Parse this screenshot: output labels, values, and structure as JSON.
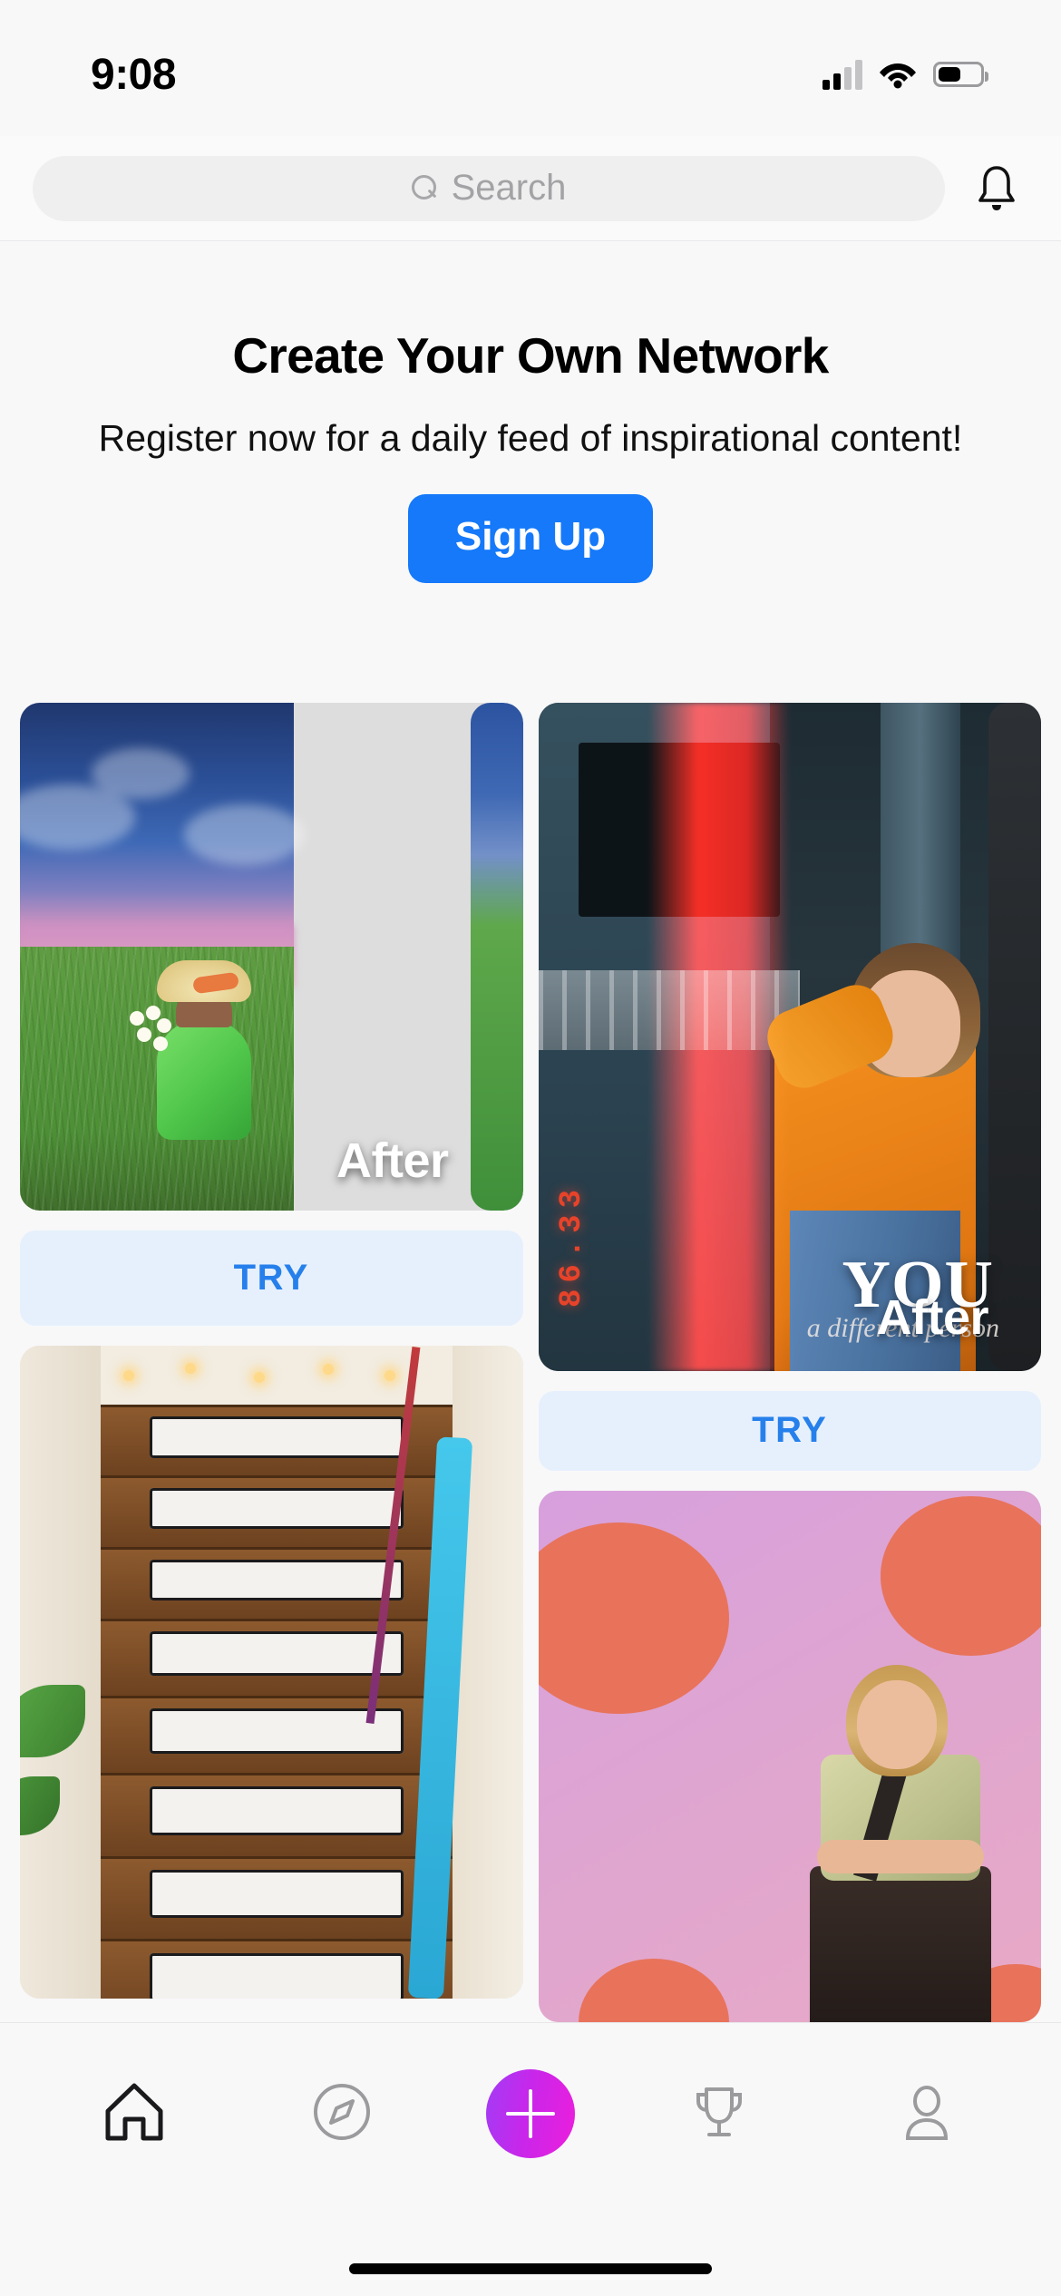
{
  "status_bar": {
    "time": "9:08",
    "cellular_icon": "cellular-signal-icon",
    "cellular_bars_filled": 2,
    "cellular_bars_total": 4,
    "wifi_icon": "wifi-icon",
    "battery_icon": "battery-icon",
    "battery_level_percent": 52
  },
  "header": {
    "search": {
      "icon": "search-icon",
      "placeholder": "Search",
      "value": ""
    },
    "notifications_icon": "bell-icon"
  },
  "promo": {
    "title": "Create Your Own Network",
    "subtitle": "Register now for a daily feed of inspirational content!",
    "signup_label": "Sign Up",
    "signup_color": "#1579f9"
  },
  "feed": {
    "try_label": "TRY",
    "try_text_color": "#2680eb",
    "try_bg_color": "#e6f0fd",
    "cards": [
      {
        "id": "card-field-after",
        "overlay_label": "After",
        "description": "woman in green dress with flowers in grass field at sunset",
        "has_try_button": true
      },
      {
        "id": "card-orange-you-after",
        "overlay_label": "After",
        "overlay_title": "YOU",
        "overlay_script": "a different person",
        "led_text": "86.33",
        "description": "woman in orange shirt leaning on building with red light streak",
        "has_try_button": true
      },
      {
        "id": "card-painted-stairs",
        "description": "wooden staircase with painted book mural and string lights",
        "has_try_button": false
      },
      {
        "id": "card-pink-dots",
        "description": "smiling woman with arms crossed against pink backdrop with orange dots",
        "has_try_button": false
      }
    ]
  },
  "tab_bar": {
    "items": [
      {
        "name": "home-tab",
        "icon": "home-icon",
        "active": true
      },
      {
        "name": "discover-tab",
        "icon": "compass-icon",
        "active": false
      },
      {
        "name": "create-tab",
        "icon": "plus-icon",
        "active": false
      },
      {
        "name": "leaderboard-tab",
        "icon": "trophy-icon",
        "active": false
      },
      {
        "name": "profile-tab",
        "icon": "person-icon",
        "active": false
      }
    ],
    "fab_gradient_start": "#a23cf5",
    "fab_gradient_end": "#ed1edc",
    "active_color": "#1a1a1c",
    "inactive_color": "#9b9b9e"
  }
}
